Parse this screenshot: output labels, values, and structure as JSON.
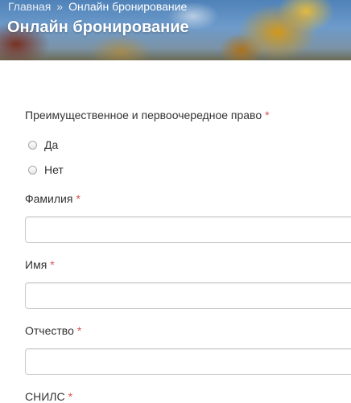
{
  "breadcrumb": {
    "home": "Главная",
    "separator": "»",
    "current": "Онлайн бронирование"
  },
  "page": {
    "title": "Онлайн бронирование"
  },
  "form": {
    "required_mark": "*",
    "priority": {
      "label": "Преимущественное и первоочередное право",
      "options": [
        "Да",
        "Нет"
      ],
      "selected": null
    },
    "last_name": {
      "label": "Фамилия",
      "value": ""
    },
    "first_name": {
      "label": "Имя",
      "value": ""
    },
    "patronymic": {
      "label": "Отчество",
      "value": ""
    },
    "snils": {
      "label": "СНИЛС"
    }
  },
  "colors": {
    "required": "#d9534f",
    "text": "#333333",
    "input_border": "#cccccc"
  }
}
